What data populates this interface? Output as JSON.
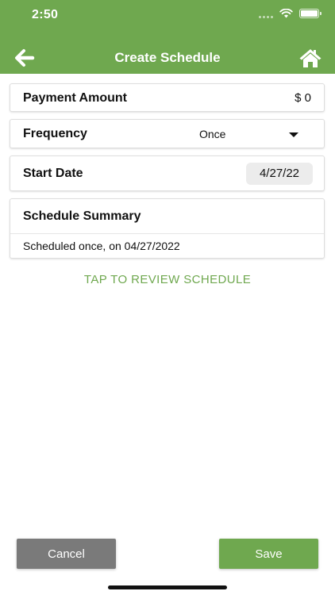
{
  "status_bar": {
    "time": "2:50",
    "icons": [
      "cellular-icon",
      "wifi-icon",
      "battery-icon"
    ]
  },
  "nav": {
    "title": "Create Schedule",
    "back_icon": "arrow-left-icon",
    "home_icon": "home-icon"
  },
  "payment_amount": {
    "label": "Payment Amount",
    "value": "$ 0"
  },
  "frequency": {
    "label": "Frequency",
    "value": "Once",
    "icon": "caret-down-icon"
  },
  "start_date": {
    "label": "Start Date",
    "value": "4/27/22"
  },
  "summary": {
    "title": "Schedule Summary",
    "text": "Scheduled once, on 04/27/2022"
  },
  "review_link": "TAP TO REVIEW SCHEDULE",
  "buttons": {
    "cancel": "Cancel",
    "save": "Save"
  },
  "colors": {
    "accent": "#6fa84f",
    "cancel": "#7a7a7a"
  }
}
